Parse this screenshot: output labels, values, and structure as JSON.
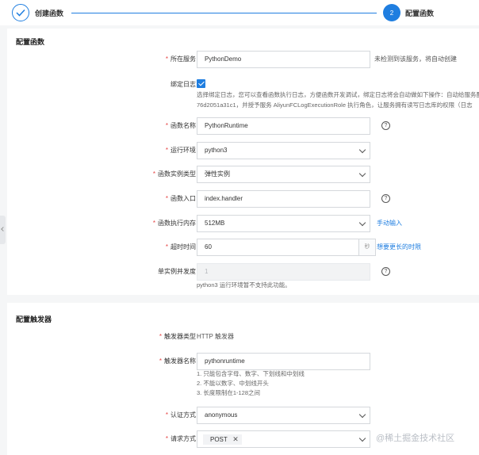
{
  "steps": {
    "step1": {
      "label": "创建函数"
    },
    "step2": {
      "number": "2",
      "label": "配置函数"
    }
  },
  "section_function": {
    "title": "配置函数",
    "service": {
      "label": "所在服务",
      "value": "PythonDemo",
      "hint": "未检测到该服务，将自动创建"
    },
    "log_binding": {
      "label": "绑定日志",
      "checked": true,
      "help_line1": "选择绑定日志，您可以查看函数执行日志，方便函数开发调试，绑定日志将会自动做如下操作：自动给服务配",
      "help_line2": "76d2051a31c1，并授予服务 AliyunFCLogExecutionRole 执行角色，让服务拥有读写日志库的权限（日志"
    },
    "function_name": {
      "label": "函数名称",
      "value": "PythonRuntime"
    },
    "runtime": {
      "label": "运行环境",
      "value": "python3"
    },
    "instance_type": {
      "label": "函数实例类型",
      "value": "弹性实例"
    },
    "handler": {
      "label": "函数入口",
      "value": "index.handler"
    },
    "memory": {
      "label": "函数执行内存",
      "value": "512MB",
      "link": "手动输入"
    },
    "timeout": {
      "label": "超时时间",
      "value": "60",
      "unit": "秒",
      "link": "想要更长的时限"
    },
    "concurrency": {
      "label": "单实例并发度",
      "value": "1",
      "note": "python3 运行环境暂不支持此功能。"
    }
  },
  "section_trigger": {
    "title": "配置触发器",
    "trigger_type": {
      "label": "触发器类型",
      "value": "HTTP 触发器"
    },
    "trigger_name": {
      "label": "触发器名称",
      "value": "pythonruntime",
      "rules": [
        "1. 只能包含字母、数字、下划线和中划线",
        "2. 不能以数字、中划线开头",
        "3. 长度限制在1-128之间"
      ]
    },
    "auth": {
      "label": "认证方式",
      "value": "anonymous"
    },
    "methods": {
      "label": "请求方式",
      "tags": [
        "POST"
      ]
    }
  },
  "watermark": "@稀土掘金技术社区",
  "colors": {
    "accent": "#1f7ee0",
    "required": "#e64545"
  }
}
